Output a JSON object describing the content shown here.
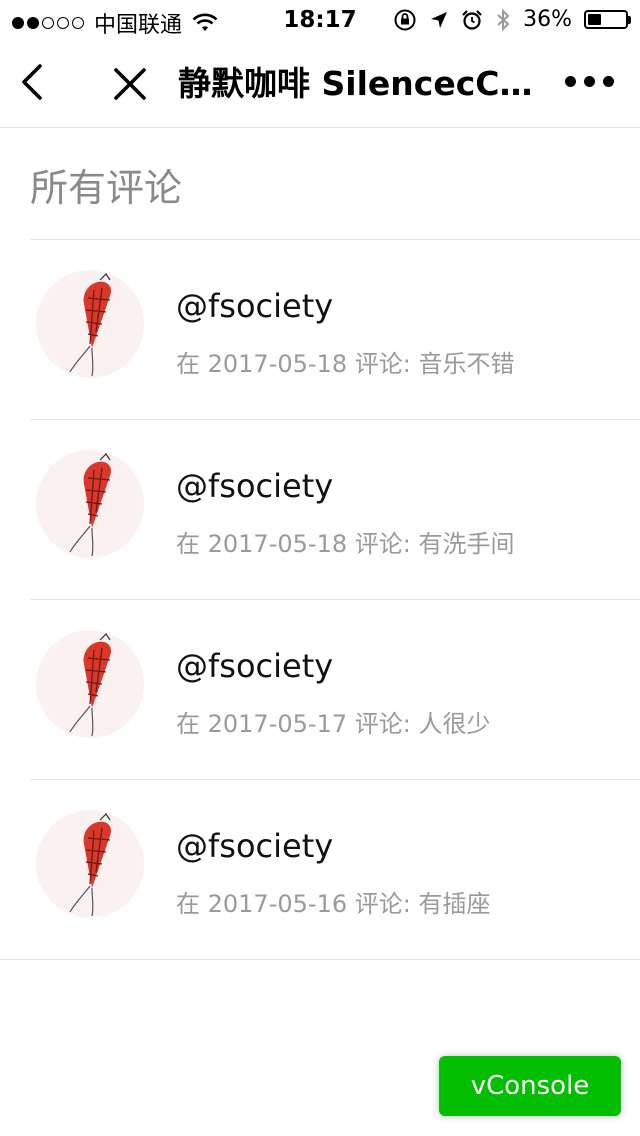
{
  "status_bar": {
    "carrier": "中国联通",
    "time": "18:17",
    "battery_percent": "36%",
    "battery_level": 0.36,
    "signal_strength": 2,
    "signal_max": 5
  },
  "nav": {
    "title": "静默咖啡 SilencecCoffee",
    "back_icon": "chevron-left-icon",
    "close_icon": "close-icon",
    "more_icon": "more-icon"
  },
  "section": {
    "title": "所有评论"
  },
  "comments": [
    {
      "username": "@fsociety",
      "meta": "在 2017-05-18 评论: 音乐不错"
    },
    {
      "username": "@fsociety",
      "meta": "在 2017-05-18 评论: 有洗手间"
    },
    {
      "username": "@fsociety",
      "meta": "在 2017-05-17 评论: 人很少"
    },
    {
      "username": "@fsociety",
      "meta": "在 2017-05-16 评论: 有插座"
    }
  ],
  "vconsole": {
    "label": "vConsole"
  },
  "colors": {
    "vconsole_green": "#04be02",
    "meta_gray": "#9a9a9a",
    "section_gray": "#8a8a8a",
    "divider": "#e5e5e5",
    "avatar_red": "#d9372a"
  }
}
